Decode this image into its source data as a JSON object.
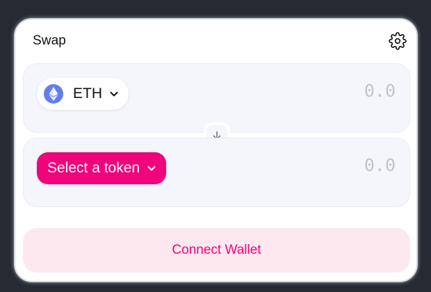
{
  "swap": {
    "title": "Swap",
    "settings_icon": "gear-icon"
  },
  "input_panel": {
    "token_symbol": "ETH",
    "token_icon": "ethereum-icon",
    "amount_placeholder": "0.0"
  },
  "switch": {
    "icon": "arrow-down-icon"
  },
  "output_panel": {
    "select_label": "Select a token",
    "amount_placeholder": "0.0"
  },
  "connect": {
    "label": "Connect Wallet"
  },
  "colors": {
    "accent": "#f0047b",
    "connect_bg": "#fde8ef",
    "panel_bg": "#f5f6fc",
    "eth": "#627eea",
    "page_bg": "#262a33"
  }
}
